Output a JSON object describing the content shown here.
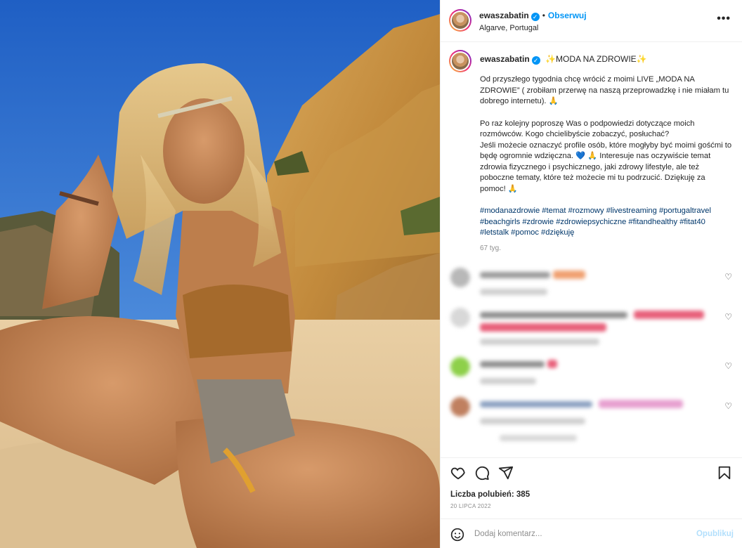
{
  "post": {
    "username": "ewaszabatin",
    "dot": "•",
    "follow_label": "Obserwuj",
    "location": "Algarve, Portugal",
    "more_label": "•••"
  },
  "caption": {
    "username": "ewaszabatin",
    "title": "✨MODA NA ZDROWIE✨",
    "paragraph_1": "Od przyszłego tygodnia chcę wrócić z moimi LIVE „MODA NA ZDROWIE” ( zrobiłam przerwę na naszą przeprowadzkę i nie miałam tu dobrego internetu). 🙏",
    "paragraph_2": "Po raz kolejny poproszę Was o podpowiedzi dotyczące moich rozmówców. Kogo chcielibyście zobaczyć, posłuchać?\nJeśli możecie oznaczyć profile osób, które mogłyby być moimi gośćmi to będę ogromnie wdzięczna. 💙 🙏 Interesuje nas oczywiście temat zdrowia fizycznego i psychicznego, jaki zdrowy lifestyle, ale też poboczne tematy, które też możecie mi tu podrzucić. Dziękuję za pomoc! 🙏",
    "hashtags": "#modanazdrowie #temat #rozmowy #livestreaming #portugaltravel #beachgirls #zdrowie #zdrowiepsychiczne #fitandhealthy #fitat40 #letstalk #pomoc #dziękuję",
    "ago": "67 tyg."
  },
  "comments_count_visible": 4,
  "actions": {
    "like_icon": "heart-icon",
    "comment_icon": "comment-icon",
    "share_icon": "share-icon",
    "save_icon": "bookmark-icon"
  },
  "likes_text": "Liczba polubień: 385",
  "date_text": "20 LIPCA 2022",
  "add_comment": {
    "placeholder": "Dodaj komentarz...",
    "publish_label": "Opublikuj"
  },
  "colors": {
    "accent": "#0095f6",
    "link": "#00376b",
    "muted": "#8e8e8e",
    "publish_disabled": "#b2dffc"
  }
}
